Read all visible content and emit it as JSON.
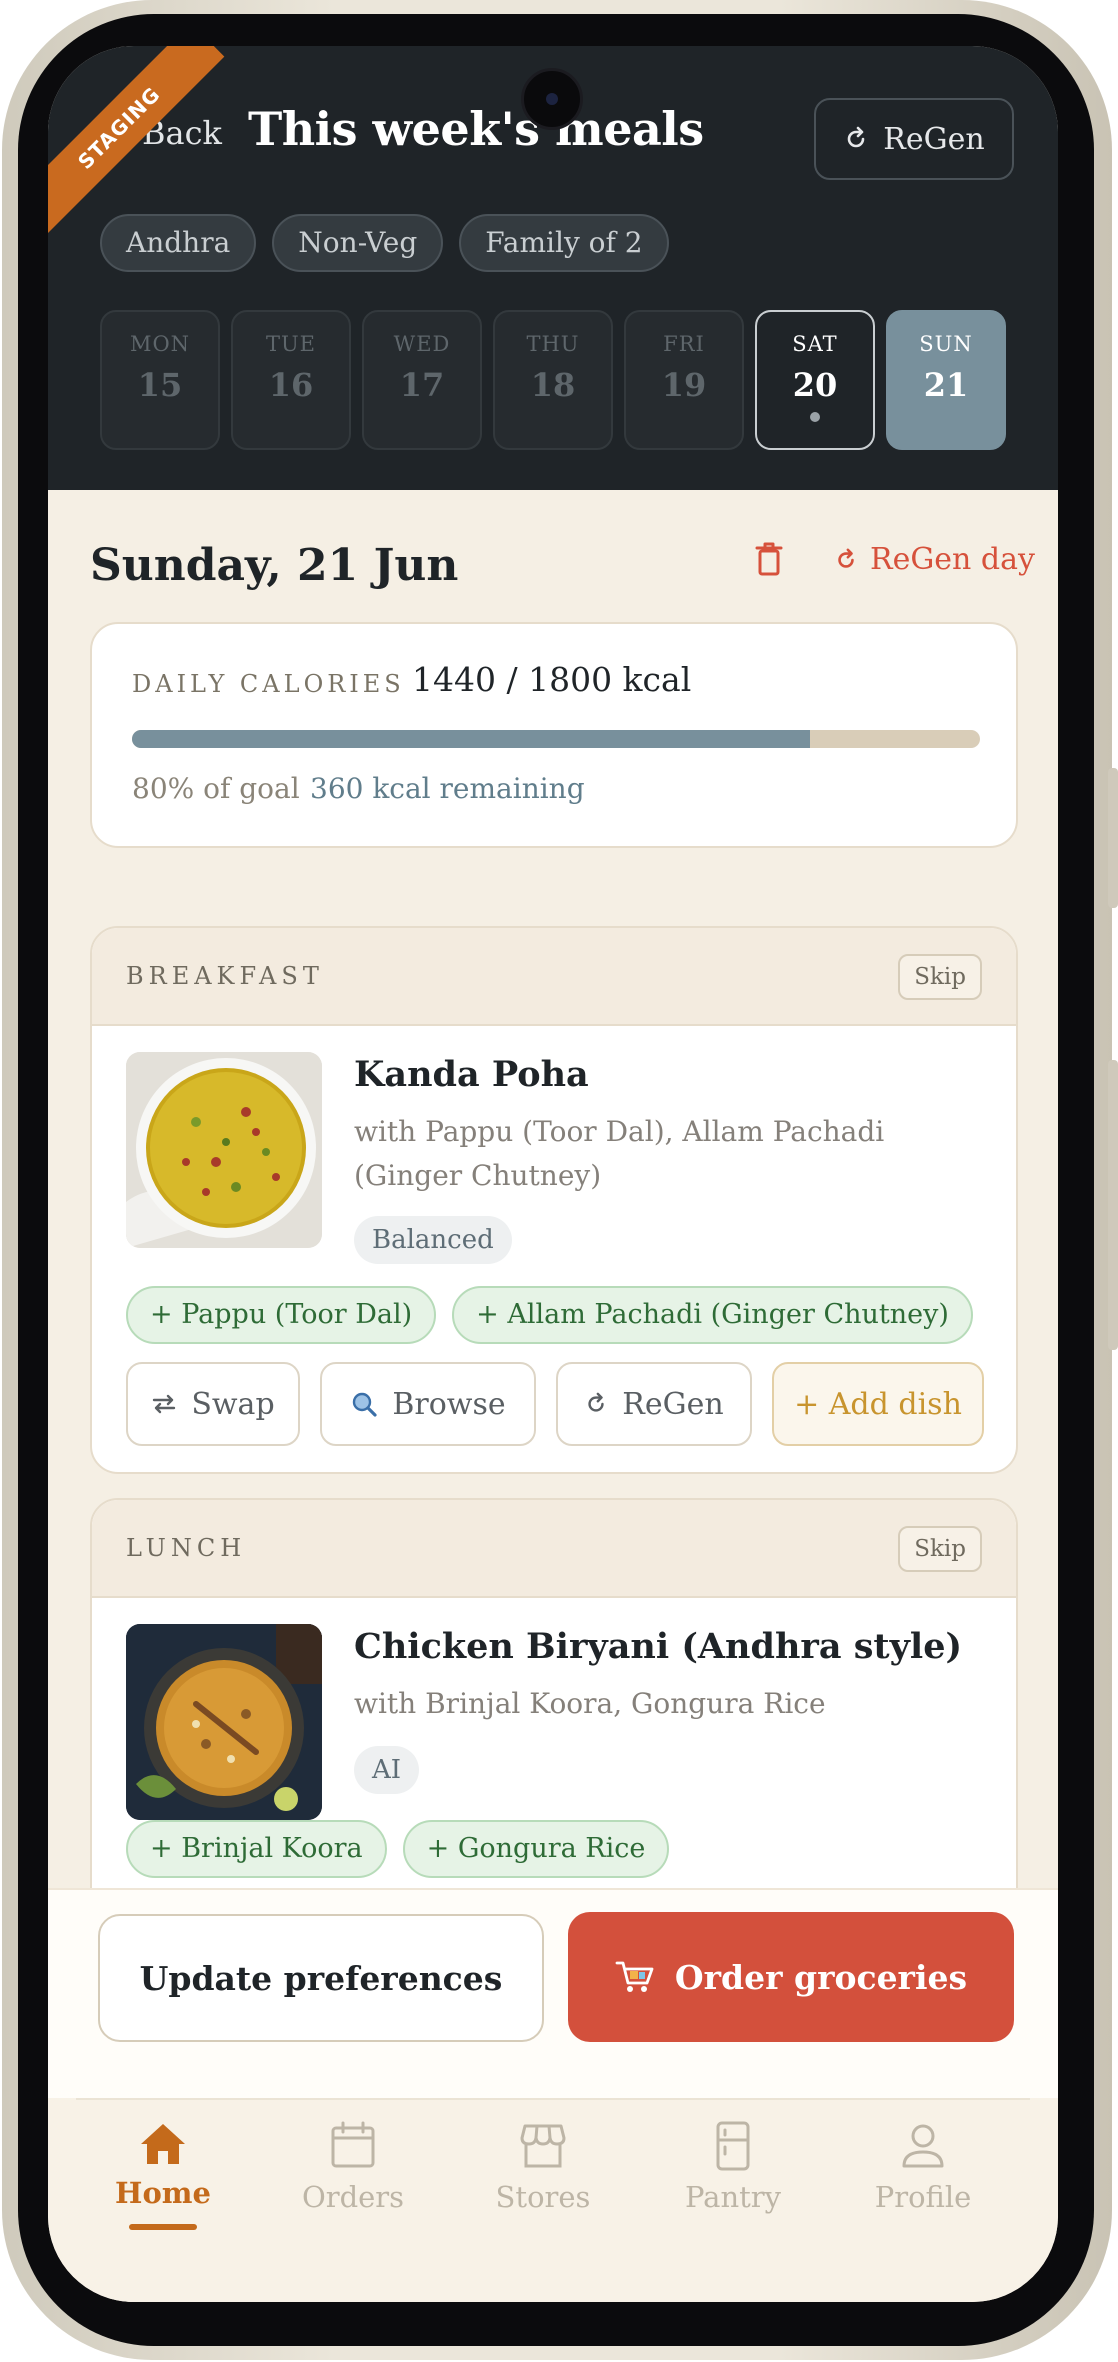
{
  "header": {
    "badge": "STAGING",
    "back_label": "Back",
    "title": "This week's meals",
    "regen_label": "ReGen",
    "chips": [
      "Andhra",
      "Non-Veg",
      "Family of 2"
    ],
    "days": [
      {
        "name": "MON",
        "date": "15"
      },
      {
        "name": "TUE",
        "date": "16"
      },
      {
        "name": "WED",
        "date": "17"
      },
      {
        "name": "THU",
        "date": "18"
      },
      {
        "name": "FRI",
        "date": "19"
      },
      {
        "name": "SAT",
        "date": "20"
      },
      {
        "name": "SUN",
        "date": "21"
      }
    ]
  },
  "day": {
    "heading": "Sunday, 21 Jun",
    "regen_day_label": "ReGen day"
  },
  "calories": {
    "label": "DAILY CALORIES",
    "value": "1440 / 1800 kcal",
    "progress": 0.8,
    "goal_text": "80% of goal",
    "remaining_text": "360 kcal remaining"
  },
  "meals": {
    "breakfast": {
      "label": "BREAKFAST",
      "skip_label": "Skip",
      "dish": "Kanda Poha",
      "with": "with Pappu (Toor Dal), Allam Pachadi (Ginger Chutney)",
      "tag": "Balanced",
      "sides": [
        "+ Pappu (Toor Dal)",
        "+ Allam Pachadi (Ginger Chutney)"
      ],
      "actions": {
        "swap": "Swap",
        "browse": "Browse",
        "regen": "ReGen",
        "add": "+ Add dish"
      }
    },
    "lunch": {
      "label": "LUNCH",
      "skip_label": "Skip",
      "dish": "Chicken Biryani (Andhra style)",
      "with": "with Brinjal Koora, Gongura Rice",
      "tag": "AI",
      "sides": [
        "+ Brinjal Koora",
        "+ Gongura Rice"
      ]
    }
  },
  "bottom_actions": {
    "update_preferences": "Update preferences",
    "order_groceries": "Order groceries"
  },
  "tabs": [
    {
      "label": "Home",
      "icon": "home-icon",
      "active": true
    },
    {
      "label": "Orders",
      "icon": "calendar-icon",
      "active": false
    },
    {
      "label": "Stores",
      "icon": "store-icon",
      "active": false
    },
    {
      "label": "Pantry",
      "icon": "fridge-icon",
      "active": false
    },
    {
      "label": "Profile",
      "icon": "person-icon",
      "active": false
    }
  ],
  "colors": {
    "header_bg": "#1f2428",
    "accent_red": "#d3503c",
    "accent_orange": "#c46a1b",
    "progress": "#78909c",
    "page_bg": "#f5efe4"
  }
}
